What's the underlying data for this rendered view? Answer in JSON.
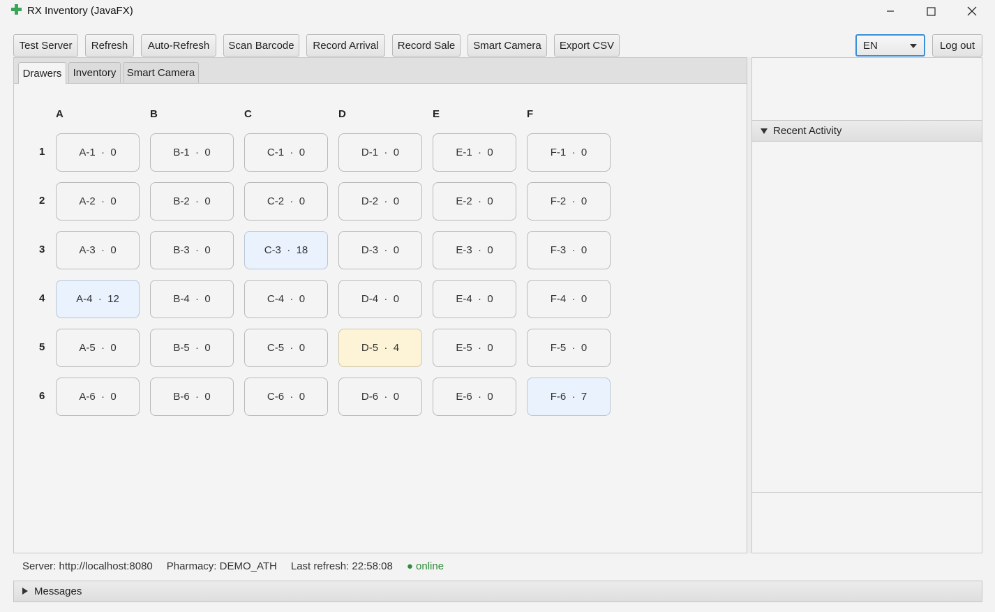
{
  "window": {
    "title": "RX Inventory (JavaFX)",
    "icon": "green-cross-icon",
    "controls": [
      "minimize-icon",
      "maximize-icon",
      "close-icon"
    ]
  },
  "toolbar": {
    "buttons": [
      {
        "label": "Test Server"
      },
      {
        "label": "Refresh"
      },
      {
        "label": "Auto-Refresh"
      },
      {
        "label": "Scan Barcode"
      },
      {
        "label": "Record Arrival"
      },
      {
        "label": "Record Sale"
      },
      {
        "label": "Smart Camera"
      },
      {
        "label": "Export CSV"
      }
    ],
    "language": {
      "selected": "EN"
    },
    "logout_label": "Log out"
  },
  "tabs": [
    {
      "label": "Drawers",
      "active": true
    },
    {
      "label": "Inventory",
      "active": false
    },
    {
      "label": "Smart Camera",
      "active": false
    }
  ],
  "drawers": {
    "columns": [
      "A",
      "B",
      "C",
      "D",
      "E",
      "F"
    ],
    "rows": [
      "1",
      "2",
      "3",
      "4",
      "5",
      "6"
    ],
    "cells": [
      [
        {
          "id": "A-1",
          "qty": "0"
        },
        {
          "id": "B-1",
          "qty": "0"
        },
        {
          "id": "C-1",
          "qty": "0"
        },
        {
          "id": "D-1",
          "qty": "0"
        },
        {
          "id": "E-1",
          "qty": "0"
        },
        {
          "id": "F-1",
          "qty": "0"
        }
      ],
      [
        {
          "id": "A-2",
          "qty": "0"
        },
        {
          "id": "B-2",
          "qty": "0"
        },
        {
          "id": "C-2",
          "qty": "0"
        },
        {
          "id": "D-2",
          "qty": "0"
        },
        {
          "id": "E-2",
          "qty": "0"
        },
        {
          "id": "F-2",
          "qty": "0"
        }
      ],
      [
        {
          "id": "A-3",
          "qty": "0"
        },
        {
          "id": "B-3",
          "qty": "0"
        },
        {
          "id": "C-3",
          "qty": "18",
          "status": "blue"
        },
        {
          "id": "D-3",
          "qty": "0"
        },
        {
          "id": "E-3",
          "qty": "0"
        },
        {
          "id": "F-3",
          "qty": "0"
        }
      ],
      [
        {
          "id": "A-4",
          "qty": "12",
          "status": "blue"
        },
        {
          "id": "B-4",
          "qty": "0"
        },
        {
          "id": "C-4",
          "qty": "0"
        },
        {
          "id": "D-4",
          "qty": "0"
        },
        {
          "id": "E-4",
          "qty": "0"
        },
        {
          "id": "F-4",
          "qty": "0"
        }
      ],
      [
        {
          "id": "A-5",
          "qty": "0"
        },
        {
          "id": "B-5",
          "qty": "0"
        },
        {
          "id": "C-5",
          "qty": "0"
        },
        {
          "id": "D-5",
          "qty": "4",
          "status": "yellow"
        },
        {
          "id": "E-5",
          "qty": "0"
        },
        {
          "id": "F-5",
          "qty": "0"
        }
      ],
      [
        {
          "id": "A-6",
          "qty": "0"
        },
        {
          "id": "B-6",
          "qty": "0"
        },
        {
          "id": "C-6",
          "qty": "0"
        },
        {
          "id": "D-6",
          "qty": "0"
        },
        {
          "id": "E-6",
          "qty": "0"
        },
        {
          "id": "F-6",
          "qty": "7",
          "status": "blue"
        }
      ]
    ],
    "separator": "·",
    "colors": {
      "blue": "#eaf2fd",
      "yellow": "#fdf4d7",
      "default": "#f4f4f4"
    }
  },
  "recent_activity": {
    "label": "Recent Activity"
  },
  "status": {
    "server": "Server: http://localhost:8080",
    "pharmacy": "Pharmacy: DEMO_ATH",
    "last_refresh": "Last refresh: 22:58:08",
    "online": "● online",
    "online_color": "#2e8b3a"
  },
  "messages": {
    "label": "Messages"
  }
}
